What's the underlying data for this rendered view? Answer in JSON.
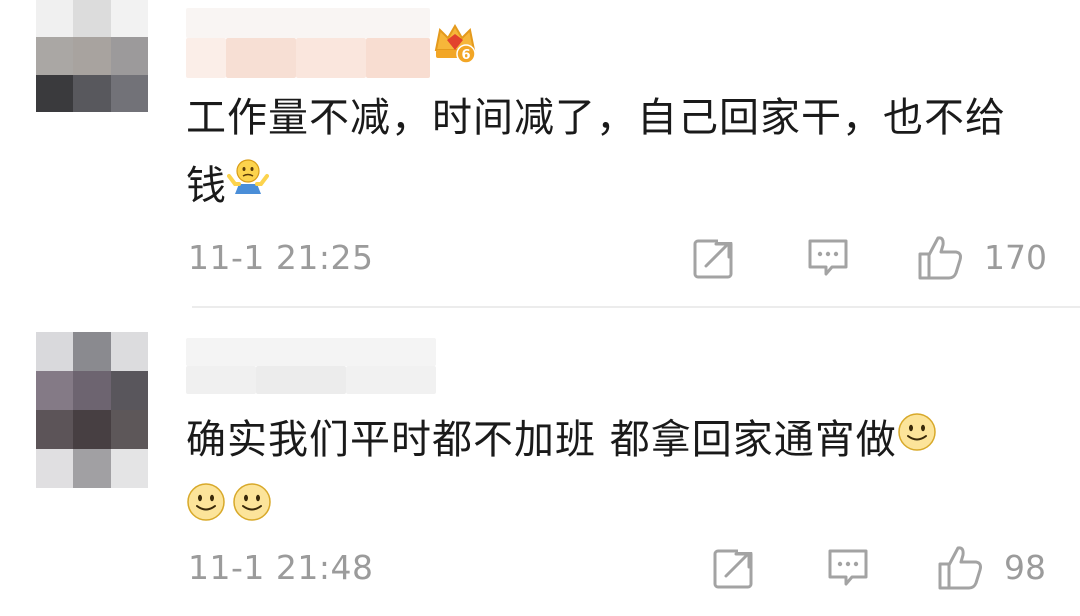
{
  "comments": [
    {
      "text": "工作量不减，时间减了，自己回家干，也不给钱",
      "time": "11-1 21:25",
      "likes": "170",
      "badge_level": "6",
      "trailing_emoji": "shrug-emoji-icon"
    },
    {
      "text": "确实我们平时都不加班 都拿回家通宵做",
      "time": "11-1 21:48",
      "likes": "98",
      "trailing_emoji": "smile-emoji-icon"
    }
  ]
}
